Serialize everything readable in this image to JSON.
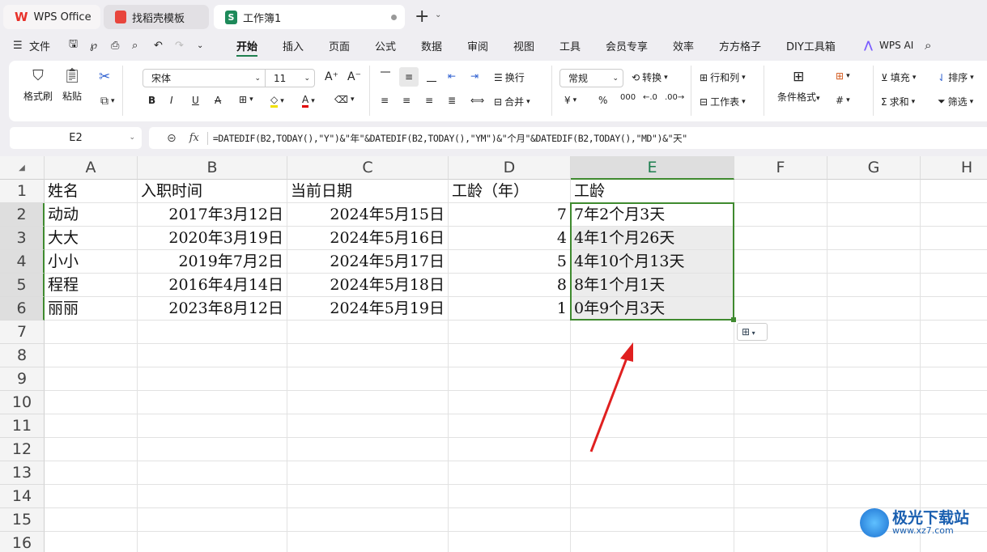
{
  "tabs": [
    {
      "label": "WPS Office"
    },
    {
      "label": "找稻壳模板"
    },
    {
      "label": "工作簿1"
    }
  ],
  "menu": {
    "file": "文件",
    "items": [
      "开始",
      "插入",
      "页面",
      "公式",
      "数据",
      "审阅",
      "视图",
      "工具",
      "会员专享",
      "效率",
      "方方格子",
      "DIY工具箱"
    ],
    "active": "开始",
    "ai": "WPS AI"
  },
  "ribbon": {
    "format_painter": "格式刷",
    "paste": "粘贴",
    "font": "宋体",
    "size": "11",
    "wrap": "换行",
    "merge": "合并",
    "number_format": "常规",
    "convert": "转换",
    "rows_cols": "行和列",
    "worksheet": "工作表",
    "cond_format": "条件格式",
    "fill": "填充",
    "sort": "排序",
    "sum": "求和",
    "filter": "筛选",
    "currency": "¥"
  },
  "formula_bar": {
    "cell_ref": "E2",
    "fx": "fx",
    "formula": "=DATEDIF(B2,TODAY(),\"Y\")&\"年\"&DATEDIF(B2,TODAY(),\"YM\")&\"个月\"&DATEDIF(B2,TODAY(),\"MD\")&\"天\""
  },
  "columns": [
    "A",
    "B",
    "C",
    "D",
    "E",
    "F",
    "G",
    "H"
  ],
  "rows": [
    "1",
    "2",
    "3",
    "4",
    "5",
    "6",
    "7",
    "8",
    "9",
    "10",
    "11",
    "12",
    "13",
    "14",
    "15",
    "16"
  ],
  "table": [
    [
      "姓名",
      "入职时间",
      "当前日期",
      "工龄（年）",
      "工龄"
    ],
    [
      "动动",
      "2017年3月12日",
      "2024年5月15日",
      "7",
      "7年2个月3天"
    ],
    [
      "大大",
      "2020年3月19日",
      "2024年5月16日",
      "4",
      "4年1个月26天"
    ],
    [
      "小小",
      "2019年7月2日",
      "2024年5月17日",
      "5",
      "4年10个月13天"
    ],
    [
      "程程",
      "2016年4月14日",
      "2024年5月18日",
      "8",
      "8年1个月1天"
    ],
    [
      "丽丽",
      "2023年8月12日",
      "2024年5月19日",
      "1",
      "0年9个月3天"
    ]
  ],
  "selection": "E2:E6",
  "colors": {
    "accent": "#1e7f4f",
    "selection": "#3f8a2f",
    "arrow": "#e02020"
  },
  "watermark": {
    "name": "极光下载站",
    "url": "www.xz7.com"
  }
}
